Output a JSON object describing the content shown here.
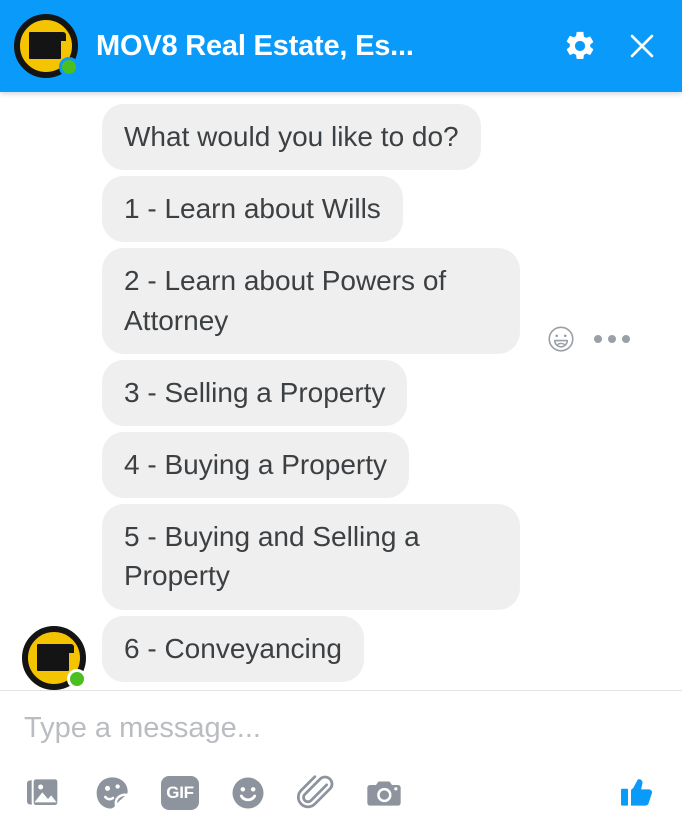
{
  "header": {
    "title": "MOV8 Real Estate, Es...",
    "avatar_name": "page-avatar",
    "online_status": "online",
    "settings_label": "Settings",
    "close_label": "Close",
    "background_color": "#0a9bfa",
    "avatar_color": "#f5c400",
    "online_dot_color": "#4bbf20"
  },
  "conversation": {
    "bubble_color": "#efefef",
    "bubble_text_color": "#3c4043",
    "messages": [
      {
        "id": 1,
        "text": "What would you like to do?",
        "sender": "page",
        "has_tools": false,
        "show_avatar": false
      },
      {
        "id": 2,
        "text": "1 -  Learn about Wills",
        "sender": "page",
        "has_tools": false,
        "show_avatar": false
      },
      {
        "id": 3,
        "text": "2 - Learn about Powers of Attorney",
        "sender": "page",
        "has_tools": true,
        "show_avatar": false
      },
      {
        "id": 4,
        "text": "3 - Selling a Property",
        "sender": "page",
        "has_tools": false,
        "show_avatar": false
      },
      {
        "id": 5,
        "text": "4 - Buying a Property",
        "sender": "page",
        "has_tools": false,
        "show_avatar": false
      },
      {
        "id": 6,
        "text": "5 - Buying and Selling a Property",
        "sender": "page",
        "has_tools": false,
        "show_avatar": false
      },
      {
        "id": 7,
        "text": "6 - Conveyancing",
        "sender": "page",
        "has_tools": false,
        "show_avatar": true
      }
    ],
    "tools": {
      "react_label": "React",
      "more_label": "More options"
    }
  },
  "composer": {
    "placeholder": "Type a message...",
    "value": "",
    "actions": [
      {
        "name": "photos",
        "label": "Photos"
      },
      {
        "name": "stickers",
        "label": "Stickers"
      },
      {
        "name": "gif",
        "label": "GIF"
      },
      {
        "name": "emoji",
        "label": "Emoji"
      },
      {
        "name": "attachment",
        "label": "Attach a file"
      },
      {
        "name": "camera",
        "label": "Camera"
      }
    ],
    "like_label": "Send a Like",
    "like_color": "#0a9bfa",
    "icon_color": "#8d949e"
  }
}
